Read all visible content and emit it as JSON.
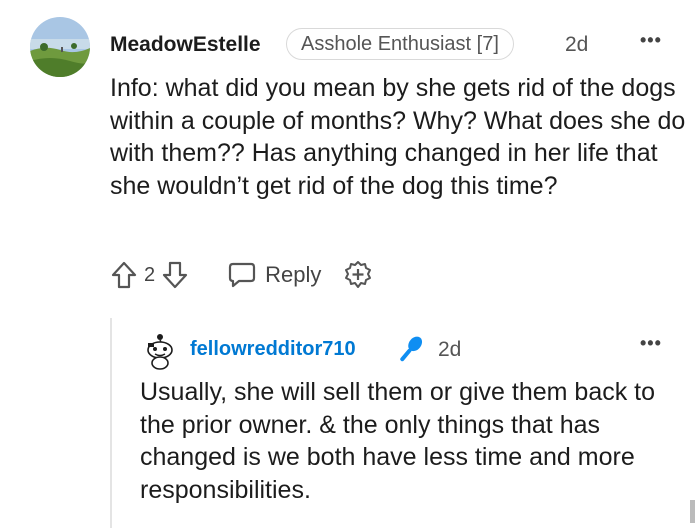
{
  "comment": {
    "author": "MeadowEstelle",
    "flair": "Asshole Enthusiast [7]",
    "time": "2d",
    "more": "•••",
    "body": "Info: what did you mean by she gets rid of the dogs within a couple of months? Why? What does she do with them?? Has anything changed in her life that she wouldn’t get rid of the dog this time?",
    "score": "2",
    "reply_label": "Reply",
    "avatar_icon": "landscape-avatar-icon"
  },
  "reply": {
    "author": "fellowredditor710",
    "time": "2d",
    "more": "•••",
    "body": "Usually, she will sell them or give them back to the prior owner. & the only things that has changed is we both have less time and more responsibilities.",
    "author_badge_icon": "microphone-icon",
    "username_color": "#0079d3"
  }
}
